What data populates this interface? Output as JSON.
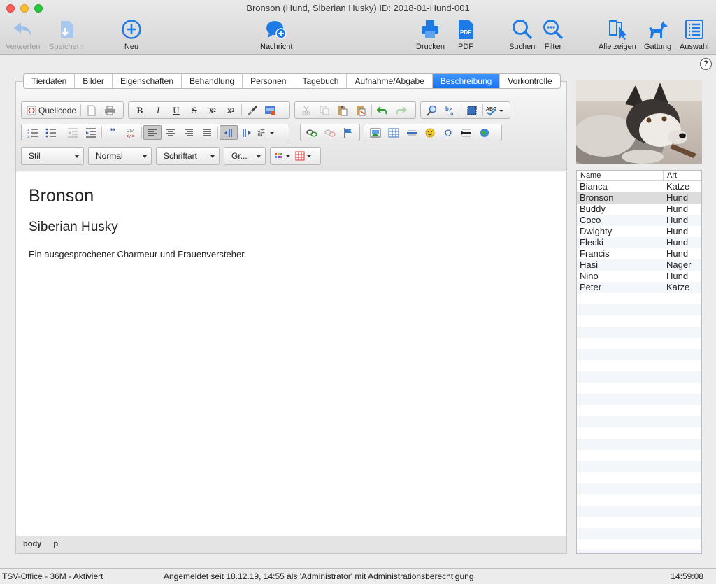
{
  "window": {
    "title": "Bronson (Hund, Siberian Husky) ID: 2018-01-Hund-001"
  },
  "toolbar": {
    "discard": "Verwerfen",
    "save": "Speichern",
    "new": "Neu",
    "message": "Nachricht",
    "print": "Drucken",
    "pdf": "PDF",
    "search": "Suchen",
    "filter": "Filter",
    "show_all": "Alle zeigen",
    "genus": "Gattung",
    "selection": "Auswahl"
  },
  "help_label": "?",
  "tabs": [
    "Tierdaten",
    "Bilder",
    "Eigenschaften",
    "Behandlung",
    "Personen",
    "Tagebuch",
    "Aufnahme/Abgabe",
    "Beschreibung",
    "Vorkontrolle"
  ],
  "active_tab": "Beschreibung",
  "editor": {
    "source_button": "Quellcode",
    "style_dropdown": "Stil",
    "format_dropdown": "Normal",
    "font_dropdown": "Schriftart",
    "size_dropdown": "Gr...",
    "heading1": "Bronson",
    "heading2": "Siberian Husky",
    "paragraph": "Ein ausgesprochener Charmeur und Frauenversteher.",
    "path": [
      "body",
      "p"
    ]
  },
  "animal_list": {
    "headers": [
      "Name",
      "Art"
    ],
    "rows": [
      {
        "name": "Bianca",
        "art": "Katze"
      },
      {
        "name": "Bronson",
        "art": "Hund"
      },
      {
        "name": "Buddy",
        "art": "Hund"
      },
      {
        "name": "Coco",
        "art": "Hund"
      },
      {
        "name": "Dwighty",
        "art": "Hund"
      },
      {
        "name": "Flecki",
        "art": "Hund"
      },
      {
        "name": "Francis",
        "art": "Hund"
      },
      {
        "name": "Hasi",
        "art": "Nager"
      },
      {
        "name": "Nino",
        "art": "Hund"
      },
      {
        "name": "Peter",
        "art": "Katze"
      }
    ],
    "selected": "Bronson"
  },
  "status": {
    "app": "TSV-Office - 36M - Aktiviert",
    "login": "Angemeldet seit 18.12.19, 14:55 als 'Administrator' mit Administrationsberechtigung",
    "time": "14:59:08"
  },
  "colors": {
    "accent": "#1a72f0",
    "icon_blue": "#1e7be6",
    "close": "#fe5f57",
    "minimize": "#febc2e",
    "maximize": "#28c840"
  }
}
